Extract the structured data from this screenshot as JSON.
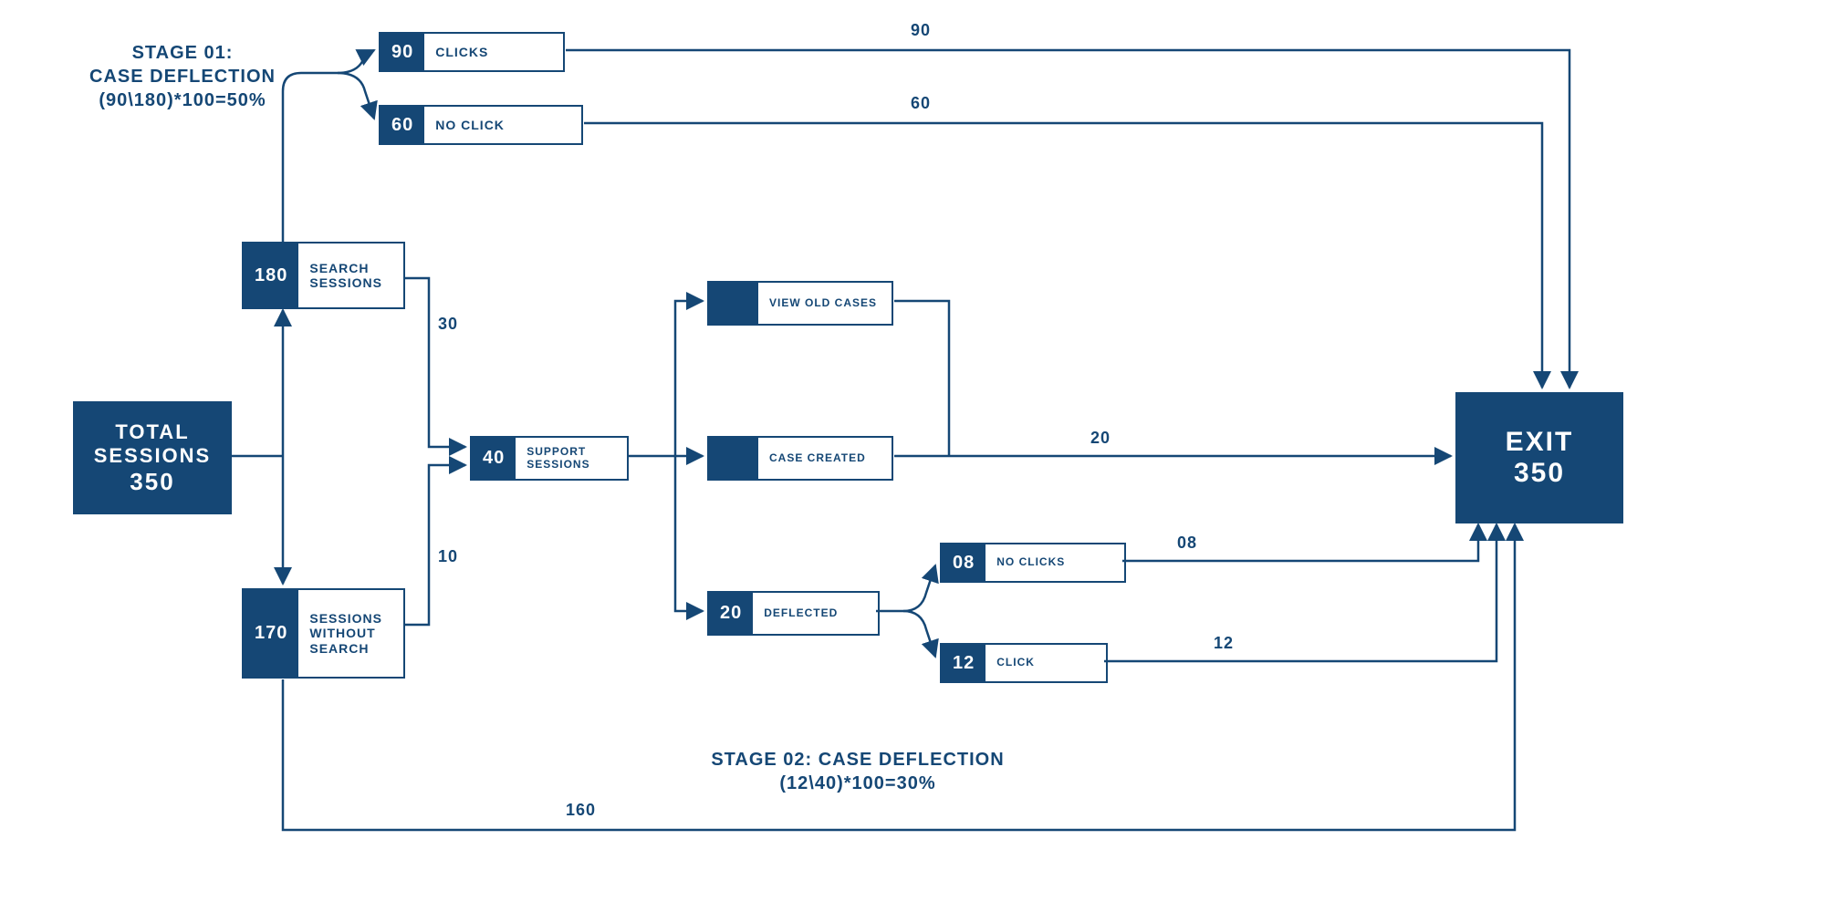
{
  "colors": {
    "brand": "#154775"
  },
  "nodes": {
    "total": {
      "label_line1": "TOTAL",
      "label_line2": "SESSIONS",
      "value": "350"
    },
    "search": {
      "value": "180",
      "label": "SEARCH SESSIONS"
    },
    "nosearch": {
      "value": "170",
      "label": "SESSIONS WITHOUT SEARCH"
    },
    "clicks": {
      "value": "90",
      "label": "CLICKS"
    },
    "noclick": {
      "value": "60",
      "label": "NO CLICK"
    },
    "support": {
      "value": "40",
      "label": "SUPPORT SESSIONS"
    },
    "viewold": {
      "value": "",
      "label": "VIEW OLD CASES"
    },
    "casecreated": {
      "value": "",
      "label": "CASE CREATED"
    },
    "deflected": {
      "value": "20",
      "label": "DEFLECTED"
    },
    "noclicks2": {
      "value": "08",
      "label": "NO CLICKS"
    },
    "click2": {
      "value": "12",
      "label": "CLICK"
    },
    "exit": {
      "label": "EXIT",
      "value": "350"
    }
  },
  "edgeLabels": {
    "e90": "90",
    "e60": "60",
    "e30": "30",
    "e10": "10",
    "e20": "20",
    "e08": "08",
    "e12": "12",
    "e160": "160"
  },
  "stages": {
    "s1_line1": "STAGE 01:",
    "s1_line2": "CASE DEFLECTION",
    "s1_line3": "(90\\180)*100=50%",
    "s2_line1": "STAGE 02: CASE DEFLECTION",
    "s2_line2": "(12\\40)*100=30%"
  },
  "chart_data": {
    "type": "sankey-flow",
    "title": "Case Deflection Flow",
    "total_sessions": 350,
    "exit_sessions": 350,
    "flows": [
      {
        "from": "Total Sessions",
        "to": "Search Sessions",
        "value": 180
      },
      {
        "from": "Total Sessions",
        "to": "Sessions Without Search",
        "value": 170
      },
      {
        "from": "Search Sessions",
        "to": "Clicks",
        "value": 90
      },
      {
        "from": "Search Sessions",
        "to": "No Click",
        "value": 60
      },
      {
        "from": "Search Sessions",
        "to": "Support Sessions",
        "value": 30
      },
      {
        "from": "Sessions Without Search",
        "to": "Support Sessions",
        "value": 10
      },
      {
        "from": "Sessions Without Search",
        "to": "Exit",
        "value": 160
      },
      {
        "from": "Clicks",
        "to": "Exit",
        "value": 90
      },
      {
        "from": "No Click",
        "to": "Exit",
        "value": 60
      },
      {
        "from": "Support Sessions",
        "to": "View Old Cases",
        "value": null
      },
      {
        "from": "Support Sessions",
        "to": "Case Created",
        "value": null
      },
      {
        "from": "Support Sessions",
        "to": "Deflected",
        "value": 20
      },
      {
        "from": "View Old Cases",
        "to": "Exit",
        "value": null
      },
      {
        "from": "Case Created",
        "to": "Exit",
        "value": 20
      },
      {
        "from": "Deflected",
        "to": "No Clicks",
        "value": 8
      },
      {
        "from": "Deflected",
        "to": "Click",
        "value": 12
      },
      {
        "from": "No Clicks",
        "to": "Exit",
        "value": 8
      },
      {
        "from": "Click",
        "to": "Exit",
        "value": 12
      }
    ],
    "stages": [
      {
        "name": "Stage 01: Case Deflection",
        "formula": "(90/180)*100",
        "result_pct": 50
      },
      {
        "name": "Stage 02: Case Deflection",
        "formula": "(12/40)*100",
        "result_pct": 30
      }
    ]
  }
}
